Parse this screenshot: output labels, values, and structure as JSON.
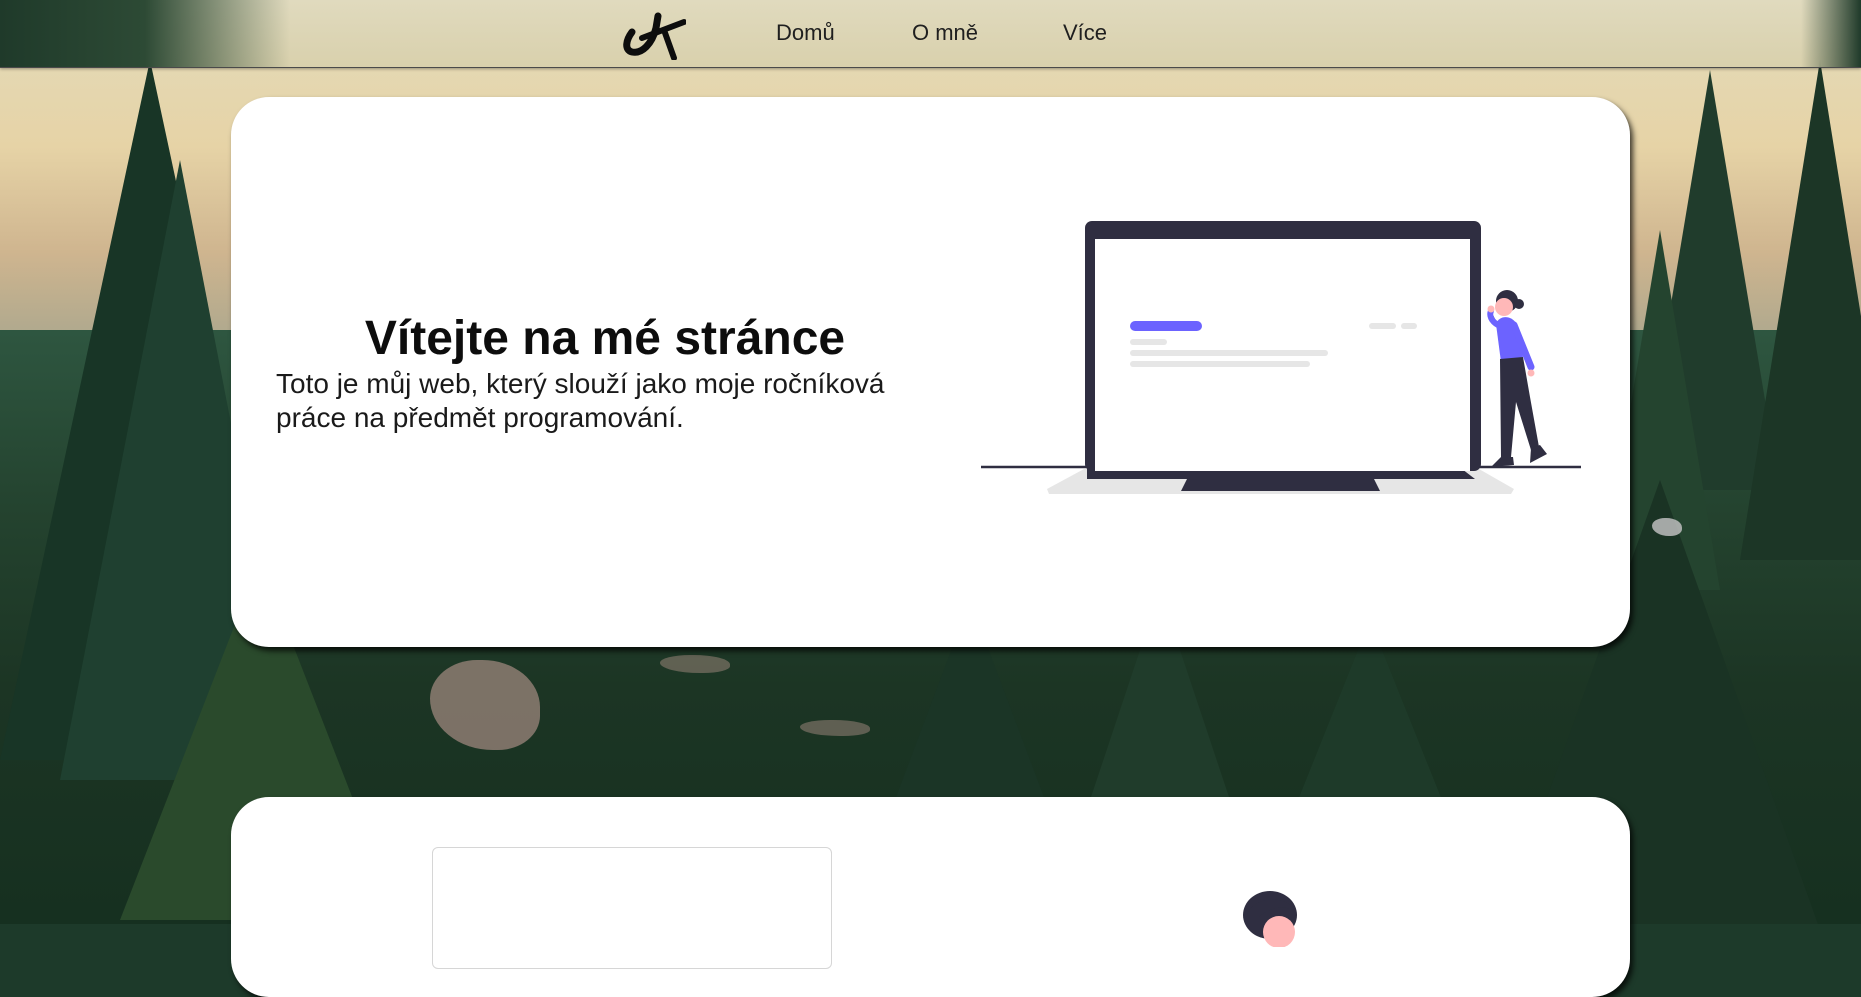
{
  "nav": {
    "logo": "logo-icon",
    "links": [
      "Domů",
      "O mně",
      "Více"
    ]
  },
  "hero": {
    "title": "Vítejte na mé stránce",
    "text": "Toto je můj web, který slouží jako moje ročníková práce na předmět programování."
  },
  "colors": {
    "accent": "#6c63ff",
    "dark": "#2f2e41",
    "card": "#ffffff"
  }
}
